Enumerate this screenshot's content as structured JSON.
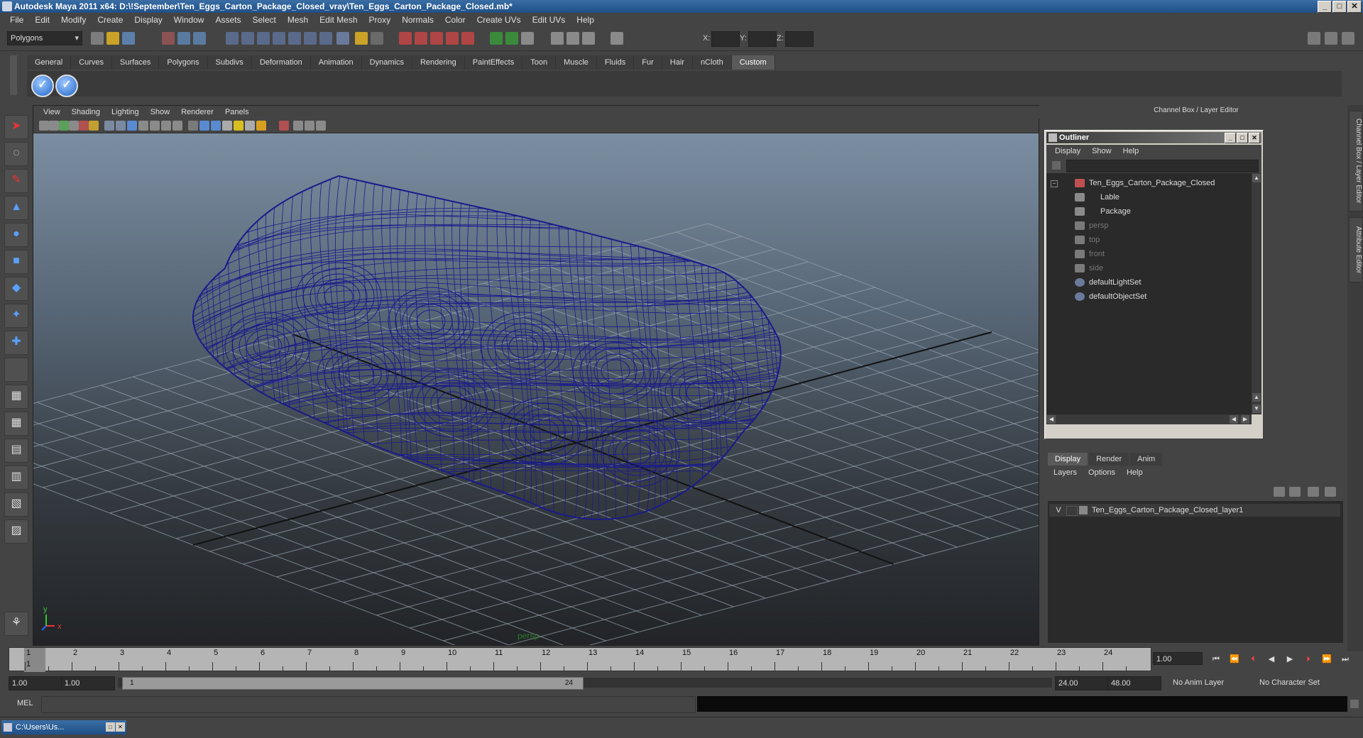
{
  "window": {
    "title": "Autodesk Maya 2011 x64: D:\\!September\\Ten_Eggs_Carton_Package_Closed_vray\\Ten_Eggs_Carton_Package_Closed.mb*",
    "min": "_",
    "max": "□",
    "close": "✕"
  },
  "menubar": [
    "File",
    "Edit",
    "Modify",
    "Create",
    "Display",
    "Window",
    "Assets",
    "Select",
    "Mesh",
    "Edit Mesh",
    "Proxy",
    "Normals",
    "Color",
    "Create UVs",
    "Edit UVs",
    "Help"
  ],
  "statusline": {
    "mode": "Polygons",
    "x_label": "X:",
    "y_label": "Y:",
    "z_label": "Z:"
  },
  "shelf": {
    "tabs": [
      "General",
      "Curves",
      "Surfaces",
      "Polygons",
      "Subdivs",
      "Deformation",
      "Animation",
      "Dynamics",
      "Rendering",
      "PaintEffects",
      "Toon",
      "Muscle",
      "Fluids",
      "Fur",
      "Hair",
      "nCloth",
      "Custom"
    ],
    "active_tab": "Custom",
    "button_glyph": "✓"
  },
  "viewport": {
    "menu": [
      "View",
      "Shading",
      "Lighting",
      "Show",
      "Renderer",
      "Panels"
    ],
    "camera": "persp",
    "axis_x": "x",
    "axis_y": "y",
    "wire_color": "#1a1a8c"
  },
  "dock": {
    "header": "Channel Box / Layer Editor",
    "vtab1": "Channel Box / Layer Editor",
    "vtab2": "Attribute Editor"
  },
  "outliner": {
    "title": "Outliner",
    "menu": [
      "Display",
      "Show",
      "Help"
    ],
    "items": [
      {
        "label": "Ten_Eggs_Carton_Package_Closed",
        "dim": false
      },
      {
        "label": "Lable",
        "dim": false
      },
      {
        "label": "Package",
        "dim": false
      },
      {
        "label": "persp",
        "dim": true
      },
      {
        "label": "top",
        "dim": true
      },
      {
        "label": "front",
        "dim": true
      },
      {
        "label": "side",
        "dim": true
      },
      {
        "label": "defaultLightSet",
        "dim": false
      },
      {
        "label": "defaultObjectSet",
        "dim": false
      }
    ],
    "collapse": "−"
  },
  "layer_editor": {
    "tabs": [
      "Display",
      "Render",
      "Anim"
    ],
    "active_tab": "Display",
    "menu": [
      "Layers",
      "Options",
      "Help"
    ],
    "layer": {
      "visible": "V",
      "name": "Ten_Eggs_Carton_Package_Closed_layer1"
    }
  },
  "timeline": {
    "ticks": [
      "1",
      "2",
      "3",
      "4",
      "5",
      "6",
      "7",
      "8",
      "9",
      "10",
      "11",
      "12",
      "13",
      "14",
      "15",
      "16",
      "17",
      "18",
      "19",
      "20",
      "21",
      "22",
      "23",
      "24"
    ],
    "current_marker": "1",
    "current_frame": "1.00",
    "playback": [
      "⏮",
      "⏪",
      "⏴",
      "◀",
      "▶",
      "⏵",
      "⏩",
      "⏭"
    ]
  },
  "range": {
    "start": "1.00",
    "playback_start": "1.00",
    "bar_start": "1",
    "bar_end": "24",
    "playback_end": "24.00",
    "end": "48.00",
    "anim_layer": "No Anim Layer",
    "char_set": "No Character Set"
  },
  "command": {
    "label": "MEL"
  },
  "taskbar": {
    "label": "C:\\Users\\Us..."
  }
}
